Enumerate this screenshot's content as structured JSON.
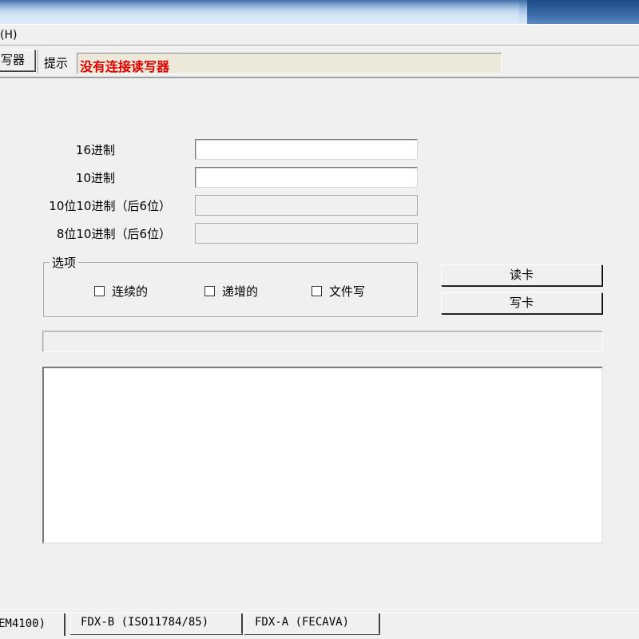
{
  "menu": {
    "help_fragment": "(H)"
  },
  "toolbar": {
    "button_label": "写器",
    "hint_label": "提示",
    "status_message": "没有连接读写器",
    "status_color": "#e00000"
  },
  "form": {
    "fields": [
      {
        "label": "16进制",
        "value": "",
        "enabled": true
      },
      {
        "label": "10进制",
        "value": "",
        "enabled": true
      },
      {
        "label": "10位10进制（后6位）",
        "value": "",
        "enabled": false
      },
      {
        "label": "8位10进制（后6位）",
        "value": "",
        "enabled": false
      }
    ]
  },
  "options": {
    "title": "选项",
    "checkboxes": [
      {
        "label": "连续的",
        "checked": false
      },
      {
        "label": "递增的",
        "checked": false
      },
      {
        "label": "文件写",
        "checked": false
      }
    ]
  },
  "buttons": {
    "read_card": "读卡",
    "write_card": "写卡"
  },
  "progress": {
    "value": 0
  },
  "log": {
    "text": ""
  },
  "tabs": [
    {
      "label": "EM4100)",
      "active": true
    },
    {
      "label": "FDX-B (ISO11784/85)",
      "active": false
    },
    {
      "label": "FDX-A (FECAVA)",
      "active": false
    }
  ]
}
